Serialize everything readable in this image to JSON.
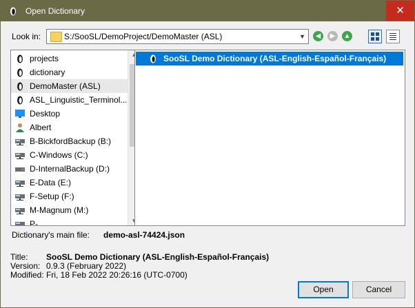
{
  "window": {
    "title": "Open Dictionary",
    "close_label": "✕"
  },
  "lookin": {
    "label": "Look in:",
    "path": "S:/SooSL/DemoProject/DemoMaster (ASL)"
  },
  "sidebar": {
    "items": [
      {
        "label": "projects",
        "icon": "soosl-icon"
      },
      {
        "label": "dictionary",
        "icon": "soosl-icon"
      },
      {
        "label": "DemoMaster (ASL)",
        "icon": "soosl-icon"
      },
      {
        "label": "ASL_Linguistic_Terminol...",
        "icon": "soosl-icon"
      },
      {
        "label": "Desktop",
        "icon": "desktop-icon"
      },
      {
        "label": "Albert",
        "icon": "user-icon"
      },
      {
        "label": "B-BickfordBackup (B:)",
        "icon": "network-drive-icon"
      },
      {
        "label": "C-Windows (C:)",
        "icon": "network-drive-icon"
      },
      {
        "label": "D-InternalBackup (D:)",
        "icon": "drive-icon"
      },
      {
        "label": "E-Data (E:)",
        "icon": "network-drive-icon"
      },
      {
        "label": "F-Setup (F:)",
        "icon": "network-drive-icon"
      },
      {
        "label": "M-Magnum (M:)",
        "icon": "network-drive-icon"
      },
      {
        "label": "P-...",
        "icon": "network-drive-icon"
      }
    ],
    "selected_index": 2
  },
  "files": {
    "rows": [
      {
        "label": "SooSL Demo Dictionary (ASL-English-Español-Français)",
        "selected": true
      }
    ]
  },
  "main_file": {
    "label": "Dictionary's main file:",
    "value": "demo-asl-74424.json"
  },
  "info": {
    "title_label": "Title:",
    "title_value": "SooSL Demo Dictionary (ASL-English-Español-Français)",
    "version_label": "Version:",
    "version_value": "0.9.3 (February 2022)",
    "modified_label": "Modified:",
    "modified_value": "Fri, 18 Feb 2022 20:26:16 (UTC-0700)"
  },
  "buttons": {
    "open": "Open",
    "cancel": "Cancel"
  },
  "colors": {
    "titlebar": "#6b6a47",
    "selection": "#0078d7",
    "close": "#c42b1c"
  }
}
